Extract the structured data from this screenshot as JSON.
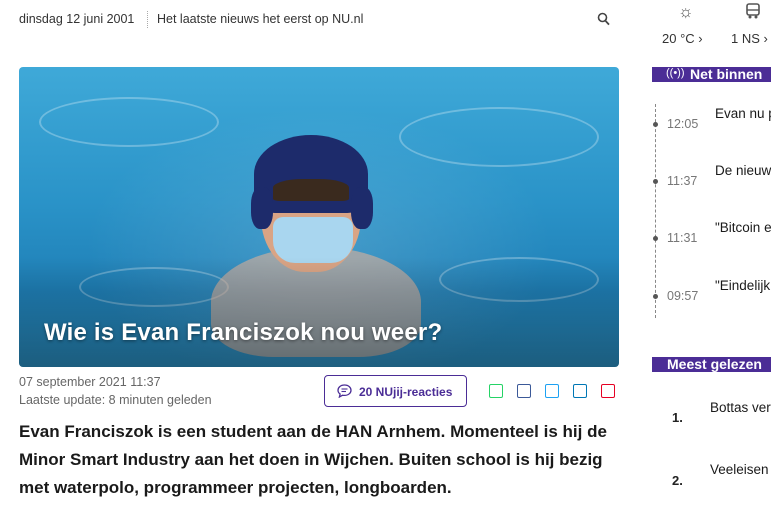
{
  "topbar": {
    "date": "dinsdag 12 juni 2001",
    "tagline": "Het laatste nieuws het eerst op NU.nl",
    "search_icon": "search-icon"
  },
  "weather": {
    "icon": "sun-icon",
    "value": "20 °C"
  },
  "traffic": {
    "icon": "car-train-icon",
    "value": "1 NS"
  },
  "article": {
    "title": "Wie is Evan Franciszok nou weer?",
    "published": "07 september 2021 11:37",
    "updated_label": "Laatste update:",
    "updated_value": "8 minuten geleden",
    "reactions": "20 NUjij-reacties",
    "intro": "Evan Franciszok is een student aan de HAN Arnhem. Momenteel is hij de Minor Smart Industry aan het doen in Wijchen. Buiten school is hij bezig met waterpolo, programmeer projecten, longboarden."
  },
  "share": [
    {
      "icon": "whatsapp-icon",
      "color": "#25d366"
    },
    {
      "icon": "facebook-icon",
      "color": "#3b5998"
    },
    {
      "icon": "twitter-icon",
      "color": "#1da1f2"
    },
    {
      "icon": "linkedin-icon",
      "color": "#0077b5"
    },
    {
      "icon": "pinterest-icon",
      "color": "#e60023"
    }
  ],
  "sidebar": {
    "net_binnen": {
      "title": "Net binnen",
      "items": [
        {
          "time": "12:05",
          "text": "Evan nu polocomm"
        },
        {
          "time": "11:37",
          "text": "De nieuw posbankt"
        },
        {
          "time": "11:31",
          "text": "\"Bitcoin e goed\", Ze"
        },
        {
          "time": "09:57",
          "text": "\"Eindelijk school, h"
        }
      ]
    },
    "meest_gelezen": {
      "title": "Meest gelezen",
      "items": [
        {
          "rank": "1.",
          "text": "Bottas ver Mercedes"
        },
        {
          "rank": "2.",
          "text": "Veeleisen supermar"
        }
      ]
    }
  },
  "colors": {
    "brand": "#4b2d96",
    "text": "#1a1a1a",
    "muted": "#666666"
  }
}
